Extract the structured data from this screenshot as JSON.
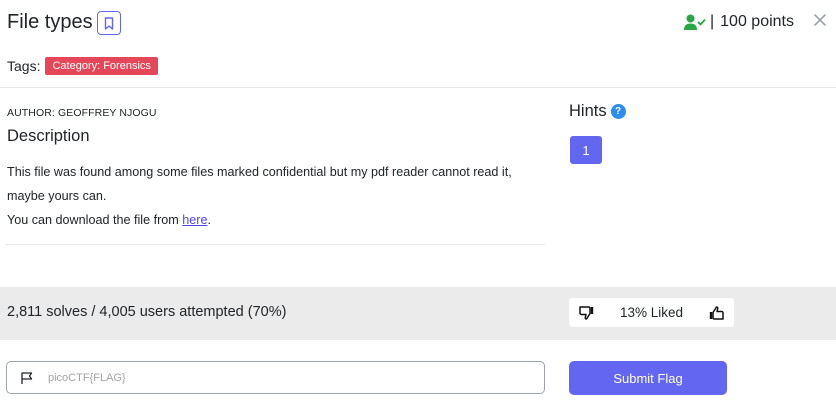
{
  "challenge": {
    "title": "File types",
    "points": "100 points",
    "separator": "|",
    "close_glyph": "✕"
  },
  "tags": {
    "label": "Tags:",
    "items": [
      "Category: Forensics"
    ]
  },
  "author": "AUTHOR: GEOFFREY NJOGU",
  "description": {
    "heading": "Description",
    "line1": "This file was found among some files marked confidential but my pdf reader cannot read it, maybe yours can.",
    "line2_prefix": "You can download the file from ",
    "link_text": "here",
    "line2_suffix": "."
  },
  "hints": {
    "heading": "Hints",
    "help_glyph": "?",
    "buttons": [
      "1"
    ]
  },
  "stats": {
    "solves_text": "2,811 solves / 4,005 users attempted (70%)",
    "liked_text": "13% Liked"
  },
  "flag": {
    "placeholder": "picoCTF{FLAG}",
    "submit_label": "Submit Flag"
  },
  "colors": {
    "accent": "#6366f1",
    "tag_red": "#e54758",
    "solved_green": "#28a745",
    "help_blue": "#2d8cf0"
  },
  "icons": [
    "bookmark-icon",
    "user-check-icon",
    "close-icon",
    "help-icon",
    "thumbs-down-icon",
    "thumbs-up-icon",
    "flag-icon"
  ]
}
